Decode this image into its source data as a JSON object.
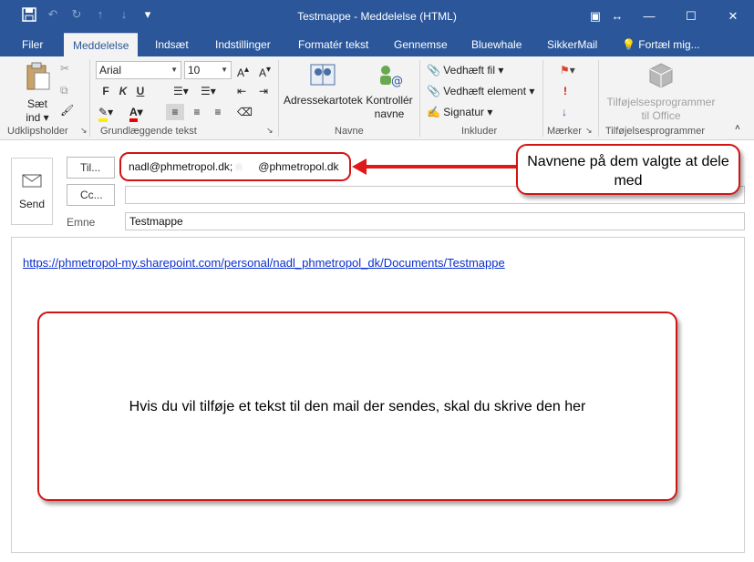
{
  "window": {
    "title": "Testmappe  -  Meddelelse (HTML)"
  },
  "tabs": [
    "Filer",
    "Meddelelse",
    "Indsæt",
    "Indstillinger",
    "Formatér tekst",
    "Gennemse",
    "Bluewhale",
    "SikkerMail",
    "Fortæl mig..."
  ],
  "ribbon": {
    "clipboard": {
      "paste_label_1": "Sæt",
      "paste_label_2": "ind",
      "group": "Udklipsholder"
    },
    "basic_text": {
      "font": "Arial",
      "size": "10",
      "group": "Grundlæggende tekst",
      "bold": "F",
      "italic": "K",
      "underline": "U"
    },
    "names": {
      "address_book": "Adressekartotek",
      "check_names_1": "Kontrollér",
      "check_names_2": "navne",
      "group": "Navne"
    },
    "include": {
      "attach_file": "Vedhæft fil",
      "attach_item": "Vedhæft element",
      "signature": "Signatur",
      "group": "Inkluder"
    },
    "tags": {
      "group": "Mærker"
    },
    "addins": {
      "label_1": "Tilføjelsesprogrammer",
      "label_2": "til Office",
      "group": "Tilføjelsesprogrammer"
    }
  },
  "compose": {
    "send": "Send",
    "to_button": "Til...",
    "cc_button": "Cc...",
    "subject_label": "Emne",
    "to_value_1": "nadl@phmetropol.dk; ",
    "to_value_blurred": "n",
    "to_value_2": "@phmetropol.dk",
    "cc_value": "",
    "subject_value": "Testmappe"
  },
  "body": {
    "link": "https://phmetropol-my.sharepoint.com/personal/nadl_phmetropol_dk/Documents/Testmappe"
  },
  "annotations": {
    "names_note": "Navnene på dem valgte at dele med",
    "body_note": "Hvis du vil tilføje et tekst til den mail der sendes, skal du skrive den her"
  },
  "colors": {
    "titlebar": "#2b579a",
    "annotation": "#d21414",
    "link": "#0b2fcc"
  }
}
